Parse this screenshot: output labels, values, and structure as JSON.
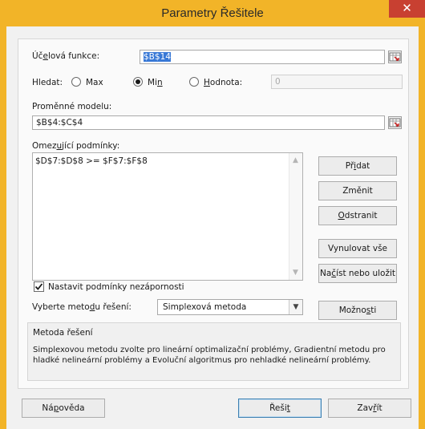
{
  "window": {
    "title": "Parametry Řešitele",
    "close_glyph": "✕"
  },
  "objective": {
    "label_pre": "Úč",
    "label_u": "e",
    "label_post": "lová funkce:",
    "value": "$B$14"
  },
  "hledat": {
    "label": "Hledat:",
    "max_label": "Max",
    "min_label_pre": "Mi",
    "min_label_u": "n",
    "min_label_post": "",
    "hodnota_label_pre": "",
    "hodnota_label_u": "H",
    "hodnota_label_post": "odnota:",
    "selected": "Min",
    "hodnota_value": "0"
  },
  "variables": {
    "label": "Proměnné modelu:",
    "value": "$B$4:$C$4"
  },
  "constraints": {
    "label_pre": "Omez",
    "label_u": "u",
    "label_post": "jící podmínky:",
    "items": [
      "$D$7:$D$8 >= $F$7:$F$8"
    ]
  },
  "buttons": {
    "add_pre": "Př",
    "add_u": "i",
    "add_post": "dat",
    "change": "Změnit",
    "delete_pre": "",
    "delete_u": "O",
    "delete_post": "dstranit",
    "reset": "Vynulovat vše",
    "load_pre": "Na",
    "load_u": "č",
    "load_post": "íst nebo uložit",
    "options_pre": "Možno",
    "options_u": "s",
    "options_post": "ti",
    "help_pre": "Ná",
    "help_u": "p",
    "help_post": "ověda",
    "solve_pre": "Řeši",
    "solve_u": "t",
    "solve_post": "",
    "close_pre": "Zav",
    "close_u": "ř",
    "close_post": "ít"
  },
  "nonneg": {
    "label": "Nastavit podmínky nezápornosti",
    "checked": true
  },
  "method": {
    "label_pre": "Vyberte meto",
    "label_u": "d",
    "label_post": "u řešení:",
    "selected": "Simplexová metoda"
  },
  "method_info": {
    "title": "Metoda řešení",
    "description": "Simplexovou metodu zvolte pro lineární optimalizační problémy, Gradientní metodu pro hladké nelineární problémy a Evoluční algoritmus pro nehladké nelineární problémy."
  },
  "icons": {
    "close": "close-icon",
    "range_ref": "range-reference-icon",
    "check": "checkmark-icon",
    "dropdown": "chevron-down-icon",
    "scroll_up": "scroll-up-icon",
    "scroll_down": "scroll-down-icon"
  }
}
